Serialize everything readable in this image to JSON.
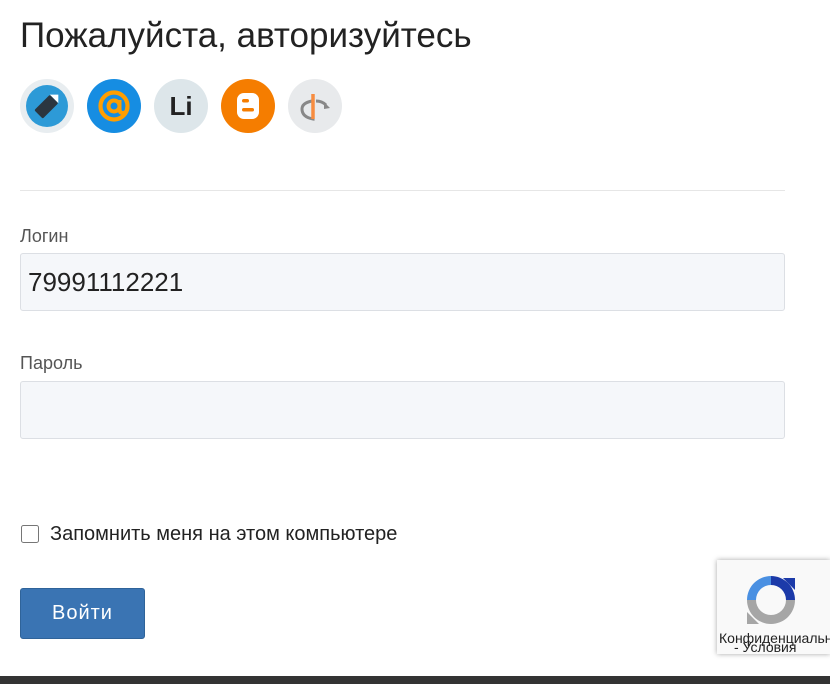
{
  "page": {
    "title": "Пожалуйста, авторизуйтесь"
  },
  "social": {
    "providers": [
      {
        "id": "livejournal",
        "icon": "livejournal-pencil-icon",
        "bg": "#e8edf0",
        "color": "#2d9ad7"
      },
      {
        "id": "mail",
        "icon": "mail-at-icon",
        "bg": "#168de2",
        "color": "#ff9e00"
      },
      {
        "id": "liveinternet",
        "icon": "liveinternet-li-icon",
        "glyph": "Li",
        "bg": "#dde6ea",
        "color": "#222222"
      },
      {
        "id": "blogger",
        "icon": "blogger-icon",
        "bg": "#f57d00",
        "color": "#ffffff"
      },
      {
        "id": "openid",
        "icon": "openid-icon",
        "bg": "#e8eaec",
        "color": "#f78c40"
      }
    ]
  },
  "form": {
    "login": {
      "label": "Логин",
      "value": "79991112221"
    },
    "password": {
      "label": "Пароль",
      "value": ""
    },
    "remember": {
      "label": "Запомнить меня на этом компьютере",
      "checked": false
    },
    "submit_label": "Войти",
    "accent_color": "#3a74b3"
  },
  "recaptcha": {
    "logo_icon": "recaptcha-logo-icon",
    "privacy_text": "Конфиденциальность",
    "terms_text": "- Условия"
  }
}
